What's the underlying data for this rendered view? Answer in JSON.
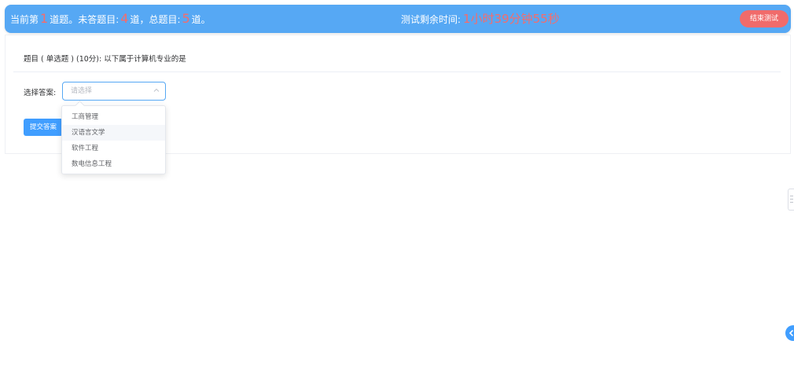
{
  "header": {
    "progress_prefix": "当前第",
    "current_question": "1",
    "progress_mid1": "道题。未答题目:",
    "unanswered": "4",
    "progress_mid2": "道，总题目:",
    "total": "5",
    "progress_suffix": "道。",
    "timer_label": "测试剩余时间:",
    "timer_value": "1小时39分钟55秒",
    "end_button": "结束测试"
  },
  "question": {
    "text": "题目 ( 单选题 ) (10分):  以下属于计算机专业的是"
  },
  "answer": {
    "label": "选择答案:",
    "placeholder": "请选择",
    "options": [
      "工商管理",
      "汉语言文学",
      "软件工程",
      "数电信息工程"
    ],
    "hovered_option": "汉语言文学"
  },
  "submit_button": "提交答案",
  "colors": {
    "header_bg": "#56a8f4",
    "accent_red": "#f56c6c",
    "primary": "#409eff"
  },
  "icons": {
    "select_arrow": "chevron-up-icon",
    "float_button": "chevron-left-icon"
  }
}
